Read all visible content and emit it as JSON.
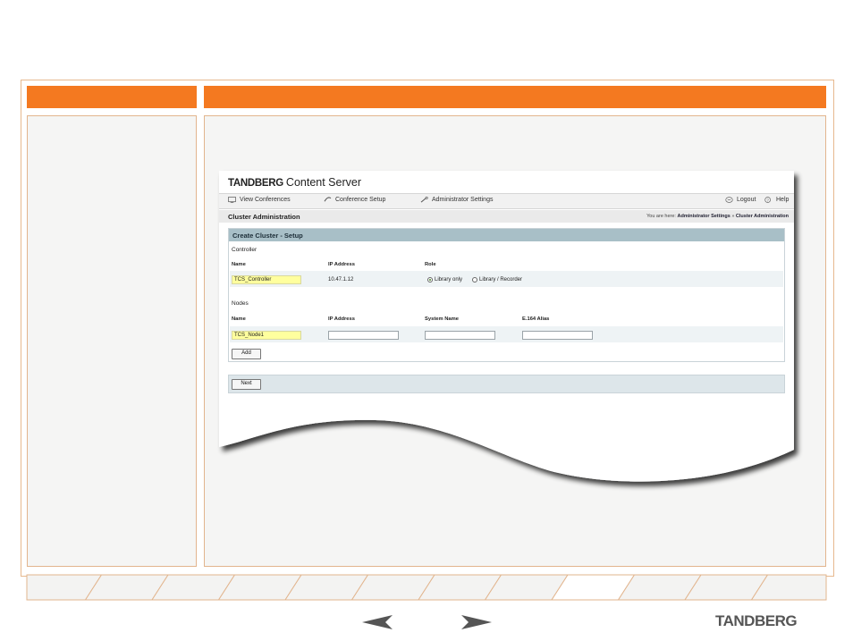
{
  "app": {
    "brand_bold": "TANDBERG",
    "brand_rest": "Content Server"
  },
  "nav": {
    "items": [
      {
        "label": "View Conferences",
        "icon": "monitor-icon"
      },
      {
        "label": "Conference Setup",
        "icon": "phone-icon"
      },
      {
        "label": "Administrator Settings",
        "icon": "wrench-icon"
      }
    ],
    "logout": "Logout",
    "help": "Help"
  },
  "page": {
    "title": "Cluster Administration",
    "breadcrumb_prefix": "You are here:",
    "breadcrumb_1": "Administrator Settings",
    "breadcrumb_sep": "»",
    "breadcrumb_2": "Cluster Administration"
  },
  "form": {
    "header": "Create Cluster - Setup",
    "controller_section": "Controller",
    "controller_cols": {
      "name": "Name",
      "ip": "IP Address",
      "role": "Role"
    },
    "controller_name": "TCS_Controller",
    "controller_ip": "10.47.1.12",
    "role_options": [
      "Library only",
      "Library / Recorder"
    ],
    "role_selected": "Library only",
    "nodes_section": "Nodes",
    "nodes_cols": {
      "name": "Name",
      "ip": "IP Address",
      "system": "System Name",
      "alias": "E.164 Alias"
    },
    "node_name": "TCS_Node1",
    "node_ip": "",
    "node_system": "",
    "node_alias": "",
    "add_label": "Add",
    "next_label": "Next"
  },
  "footer": {
    "logo": "TANDBERG",
    "tab_count": 12,
    "active_tab": 9
  },
  "colors": {
    "accent": "#f47920",
    "panel_border": "#e2b58e",
    "form_header": "#a8bfc7",
    "highlight_input": "#ffff9e"
  }
}
